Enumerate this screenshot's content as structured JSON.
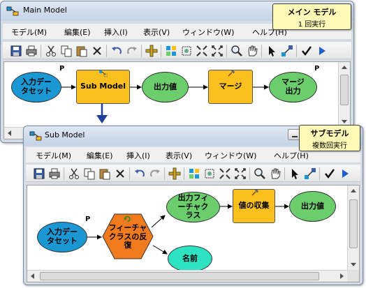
{
  "main_window": {
    "title": "Main Model",
    "callout": {
      "title": "メイン モデル",
      "subtitle": "1 回実行"
    },
    "menu": [
      "モデル(M)",
      "編集(E)",
      "挿入(I)",
      "表示(V)",
      "ウィンドウ(W)",
      "ヘルプ(H)"
    ],
    "nodes": {
      "input_dataset": "入力データセット",
      "sub_model": "Sub Model",
      "output_value": "出力値",
      "merge": "マージ",
      "merge_output": "マージ出力"
    },
    "p_marker": "P"
  },
  "sub_window": {
    "title": "Sub Model",
    "callout": {
      "title": "サブモデル",
      "subtitle": "複数回実行"
    },
    "menu": [
      "モデル(M)",
      "編集(E)",
      "挿入(I)",
      "表示(V)",
      "ウィンドウ(W)",
      "ヘルプ(H)"
    ],
    "nodes": {
      "input_dataset": "入力データセット",
      "feature_iterator": "フィーチャクラスの反復",
      "name": "名前",
      "output_feature_class": "出力フィーチャクラス",
      "collect_values": "値の収集",
      "output_value": "出力値"
    },
    "p_marker": "P"
  },
  "toolbar_icons": [
    "save-icon",
    "print-icon",
    "cut-icon",
    "copy-icon",
    "paste-icon",
    "delete-icon",
    "undo-icon",
    "redo-icon",
    "add-data-icon",
    "auto-layout-icon",
    "full-extent-icon",
    "zoom-in-fixed-icon",
    "zoom-out-fixed-icon",
    "zoom-icon",
    "pan-icon",
    "select-icon",
    "connect-icon",
    "validate-icon",
    "run-icon"
  ],
  "colors": {
    "input_blue": "#1b97d4",
    "value_green": "#6ccd6c",
    "tool_yellow": "#fcc01e",
    "iterator_orange": "#f07a1e",
    "name_cyan": "#2de3c2",
    "callout_yellow": "#fff9b8",
    "connector_blue": "#1f3f9c"
  }
}
